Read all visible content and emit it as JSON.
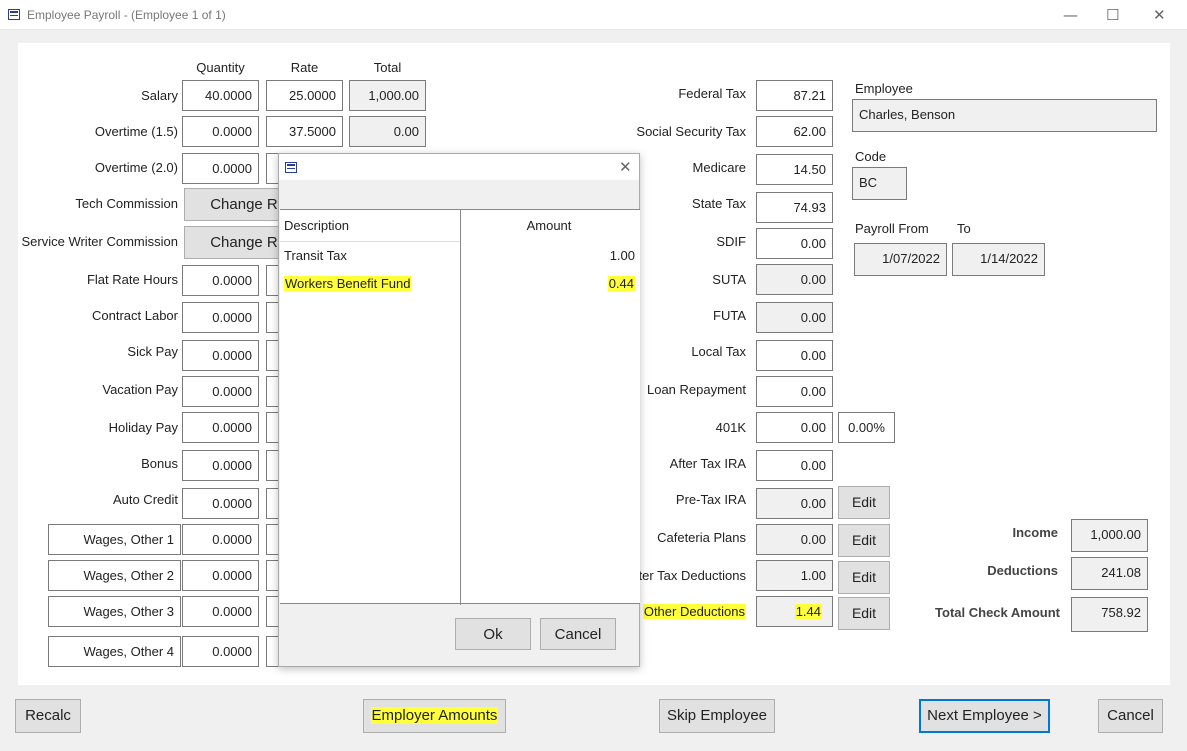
{
  "window": {
    "title": "Employee Payroll - (Employee 1 of 1)",
    "minimize": "—",
    "maximize": "☐",
    "close": "✕"
  },
  "earnings": {
    "headers": {
      "quantity": "Quantity",
      "rate": "Rate",
      "total": "Total"
    },
    "salary": {
      "label": "Salary",
      "quantity": "40.0000",
      "rate": "25.0000",
      "total": "1,000.00"
    },
    "overtime15": {
      "label": "Overtime (1.5)",
      "quantity": "0.0000",
      "rate": "37.5000",
      "total": "0.00"
    },
    "overtime20": {
      "label": "Overtime (2.0)",
      "quantity": "0.0000"
    },
    "tech_commission": {
      "label": "Tech Commission",
      "button": "Change R"
    },
    "service_writer_commission": {
      "label": "Service Writer Commission",
      "button": "Change R"
    },
    "flat_rate_hours": {
      "label": "Flat Rate Hours",
      "quantity": "0.0000"
    },
    "contract_labor": {
      "label": "Contract Labor",
      "quantity": "0.0000"
    },
    "sick_pay": {
      "label": "Sick Pay",
      "quantity": "0.0000"
    },
    "vacation_pay": {
      "label": "Vacation Pay",
      "quantity": "0.0000"
    },
    "holiday_pay": {
      "label": "Holiday Pay",
      "quantity": "0.0000"
    },
    "bonus": {
      "label": "Bonus",
      "quantity": "0.0000"
    },
    "auto_credit": {
      "label": "Auto Credit",
      "quantity": "0.0000"
    },
    "wages_other_1": {
      "label": "Wages, Other 1",
      "quantity": "0.0000"
    },
    "wages_other_2": {
      "label": "Wages, Other 2",
      "quantity": "0.0000"
    },
    "wages_other_3": {
      "label": "Wages, Other 3",
      "quantity": "0.0000"
    },
    "wages_other_4": {
      "label": "Wages, Other 4",
      "quantity": "0.0000"
    }
  },
  "deductions": {
    "federal_tax": {
      "label": "Federal Tax",
      "value": "87.21"
    },
    "social_security_tax": {
      "label": "Social Security Tax",
      "value": "62.00"
    },
    "medicare": {
      "label": "Medicare",
      "value": "14.50"
    },
    "state_tax": {
      "label": "State Tax",
      "value": "74.93"
    },
    "sdif": {
      "label": "SDIF",
      "value": "0.00"
    },
    "suta": {
      "label": "SUTA",
      "value": "0.00"
    },
    "futa": {
      "label": "FUTA",
      "value": "0.00"
    },
    "local_tax": {
      "label": "Local Tax",
      "value": "0.00"
    },
    "loan_repayment": {
      "label": "Loan Repayment",
      "value": "0.00"
    },
    "k401": {
      "label": "401K",
      "value": "0.00",
      "percent": "0.00%"
    },
    "after_tax_ira": {
      "label": "After Tax IRA",
      "value": "0.00"
    },
    "pre_tax_ira": {
      "label": "Pre-Tax IRA",
      "value": "0.00",
      "button": "Edit"
    },
    "cafeteria_plans": {
      "label": "Cafeteria Plans",
      "value": "0.00",
      "button": "Edit"
    },
    "after_tax_deductions": {
      "label": "ter Tax Deductions",
      "value": "1.00",
      "button": "Edit"
    },
    "other_deductions": {
      "label": "Other Deductions",
      "value": "1.44",
      "button": "Edit"
    }
  },
  "employee": {
    "label": "Employee",
    "name": "Charles, Benson",
    "code_label": "Code",
    "code": "BC",
    "payroll_from_label": "Payroll From",
    "to_label": "To",
    "payroll_from": "1/07/2022",
    "payroll_to": "1/14/2022"
  },
  "totals": {
    "income_label": "Income",
    "income": "1,000.00",
    "deductions_label": "Deductions",
    "deductions": "241.08",
    "check_label": "Total Check Amount",
    "check": "758.92"
  },
  "footer": {
    "recalc": "Recalc",
    "employer_amounts": "Employer Amounts",
    "skip_employee": "Skip Employee",
    "next_employee": "Next Employee >",
    "cancel": "Cancel"
  },
  "dialog": {
    "close": "✕",
    "col_description": "Description",
    "col_amount": "Amount",
    "rows": [
      {
        "description": "Transit Tax",
        "amount": "1.00"
      },
      {
        "description": "Workers Benefit Fund",
        "amount": "0.44"
      }
    ],
    "ok": "Ok",
    "cancel": "Cancel"
  },
  "colors": {
    "highlight": "#ffff3a",
    "accent": "#0078d7"
  }
}
